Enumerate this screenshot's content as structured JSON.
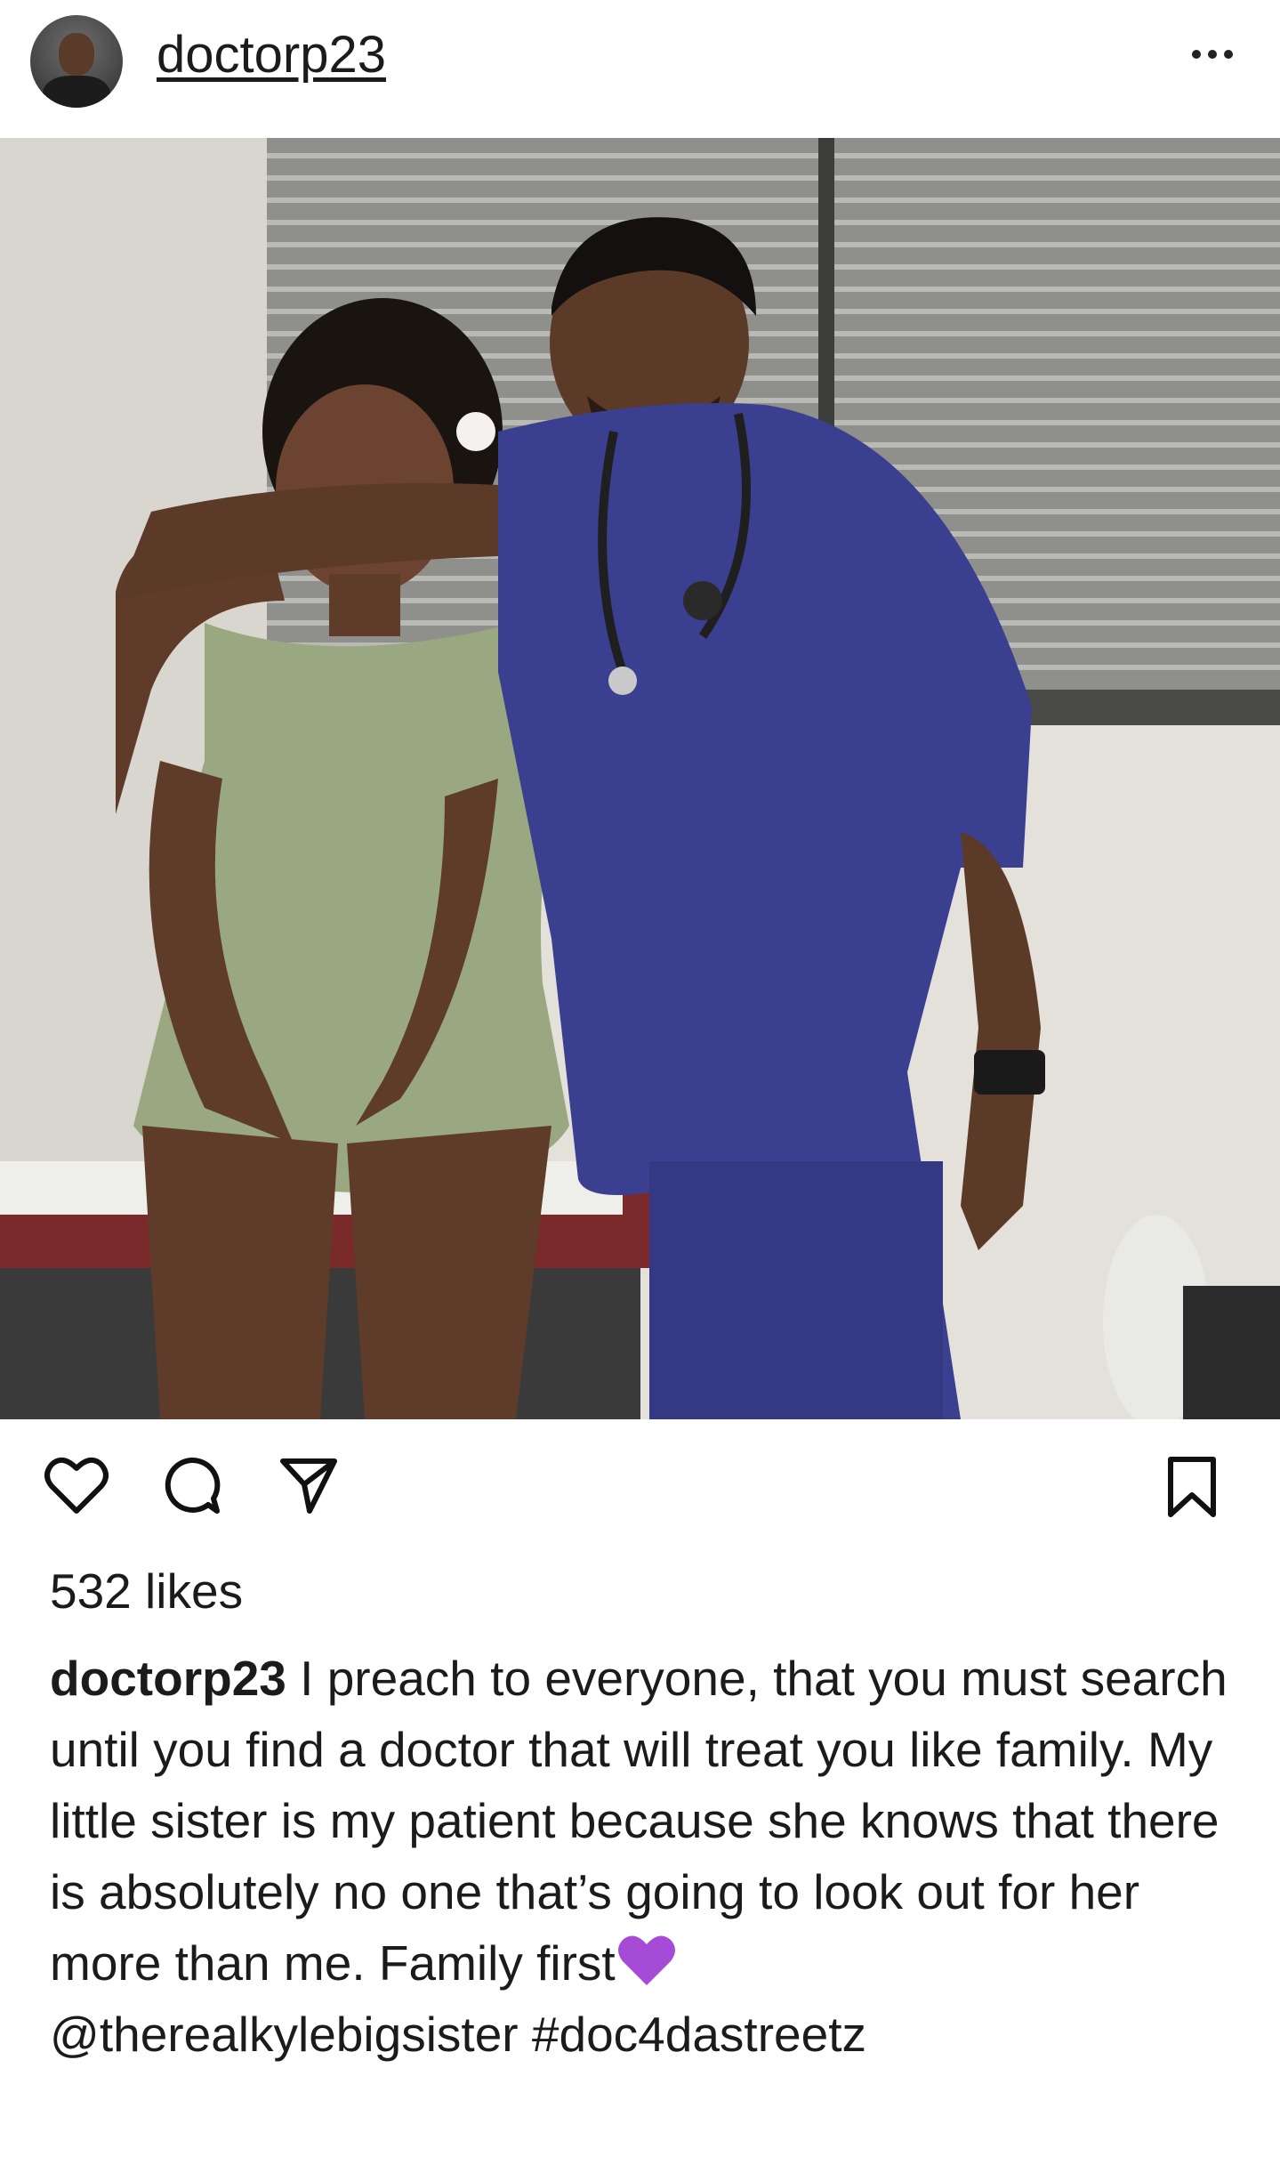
{
  "post": {
    "username": "doctorp23",
    "more_icon": "more-horizontal-icon",
    "likes": "532 likes",
    "caption_user": "doctorp23",
    "caption_text": "I preach to everyone, that you must search until you find a doctor that will treat you like family. My little sister is my patient because she knows that there is absolutely no one that’s going to look out for her more than me. Family first",
    "caption_mention": "@therealkylebigsister",
    "caption_hashtag": "#doc4dastreetz"
  },
  "actions": {
    "icons": [
      "heart-icon",
      "comment-icon",
      "share-icon",
      "save-icon"
    ]
  },
  "colors": {
    "scrubs": "#3b3f8f",
    "dress": "#9aa882",
    "heart_emoji": "#a64bd6"
  }
}
